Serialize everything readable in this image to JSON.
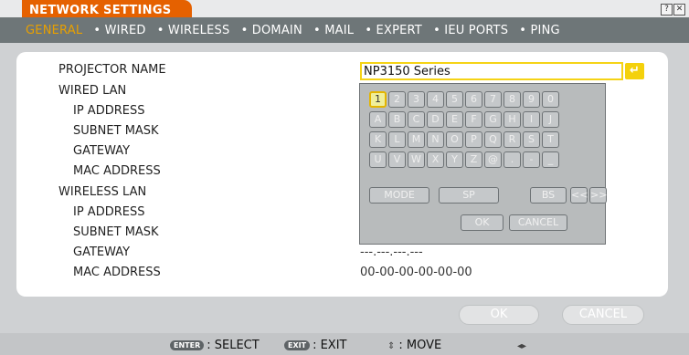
{
  "window": {
    "title": "NETWORK SETTINGS",
    "help_glyph": "?",
    "close_glyph": "✕"
  },
  "tabs": [
    {
      "label": "GENERAL"
    },
    {
      "label": "• WIRED"
    },
    {
      "label": "• WIRELESS"
    },
    {
      "label": "• DOMAIN"
    },
    {
      "label": "• MAIL"
    },
    {
      "label": "• EXPERT"
    },
    {
      "label": "• IEU PORTS"
    },
    {
      "label": "• PING"
    }
  ],
  "settings": {
    "projector_name_label": "PROJECTOR NAME",
    "projector_name_value": "NP3150 Series",
    "wired_lan_label": "WIRED LAN",
    "wired_ip_label": "IP ADDRESS",
    "wired_subnet_label": "SUBNET MASK",
    "wired_gateway_label": "GATEWAY",
    "wired_mac_label": "MAC ADDRESS",
    "wireless_lan_label": "WIRELESS LAN",
    "wireless_ip_label": "IP ADDRESS",
    "wireless_subnet_label": "SUBNET MASK",
    "wireless_gateway_label": "GATEWAY",
    "wireless_gateway_value": "---.---.---.---",
    "wireless_mac_label": "MAC ADDRESS",
    "wireless_mac_value": "00-00-00-00-00-00"
  },
  "keyboard": {
    "rows": [
      [
        "1",
        "2",
        "3",
        "4",
        "5",
        "6",
        "7",
        "8",
        "9",
        "0"
      ],
      [
        "A",
        "B",
        "C",
        "D",
        "E",
        "F",
        "G",
        "H",
        "I",
        "J"
      ],
      [
        "K",
        "L",
        "M",
        "N",
        "O",
        "P",
        "Q",
        "R",
        "S",
        "T"
      ],
      [
        "U",
        "V",
        "W",
        "X",
        "Y",
        "Z",
        "@",
        ".",
        "-",
        "_"
      ]
    ],
    "selected_key": "1",
    "mode_label": "MODE",
    "sp_label": "SP",
    "bs_label": "BS",
    "left_label": "<<",
    "right_label": ">>",
    "ok_label": "OK",
    "cancel_label": "CANCEL"
  },
  "buttons": {
    "ok": "OK",
    "cancel": "CANCEL"
  },
  "status": {
    "enter_key": "ENTER",
    "select_text": ": SELECT",
    "exit_key": "EXIT",
    "exit_text": ": EXIT",
    "move_icon": "⇕",
    "move_text": ": MOVE",
    "lr_icon": "◂▸"
  }
}
